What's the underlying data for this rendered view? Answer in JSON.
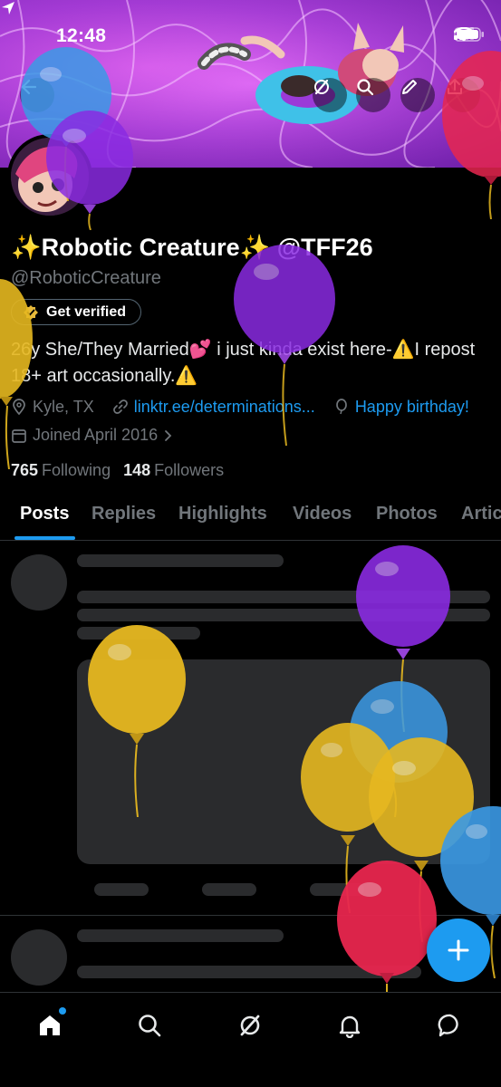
{
  "status_bar": {
    "time": "12:48"
  },
  "profile": {
    "display_name": "✨Robotic Creature✨ @TFF26",
    "handle": "@RoboticCreature",
    "verify_label": "Get verified",
    "bio": "26y She/They Married💕 i just kinda exist here-⚠️I repost 18+ art occasionally.⚠️",
    "location": "Kyle, TX",
    "link": "linktr.ee/determinations...",
    "birthday": "Happy birthday!",
    "joined": "Joined April 2016",
    "following_count": "765",
    "following_label": "Following",
    "followers_count": "148",
    "followers_label": "Followers"
  },
  "tabs": [
    "Posts",
    "Replies",
    "Highlights",
    "Videos",
    "Photos",
    "Artic"
  ],
  "active_tab": "Posts",
  "icons": {
    "back": "back-arrow-icon",
    "grok": "grok-icon",
    "search": "search-icon",
    "edit": "pencil-icon",
    "share": "share-icon",
    "compose": "plus-icon",
    "nav": [
      "home-icon",
      "search-icon",
      "grok-icon",
      "bell-icon",
      "message-icon"
    ]
  },
  "colors": {
    "accent": "#1d9bf0",
    "background": "#000000",
    "balloon_purple": "#8a2be2",
    "balloon_yellow": "#e6b820",
    "balloon_blue": "#3b9ae6",
    "balloon_red": "#e8264f"
  }
}
